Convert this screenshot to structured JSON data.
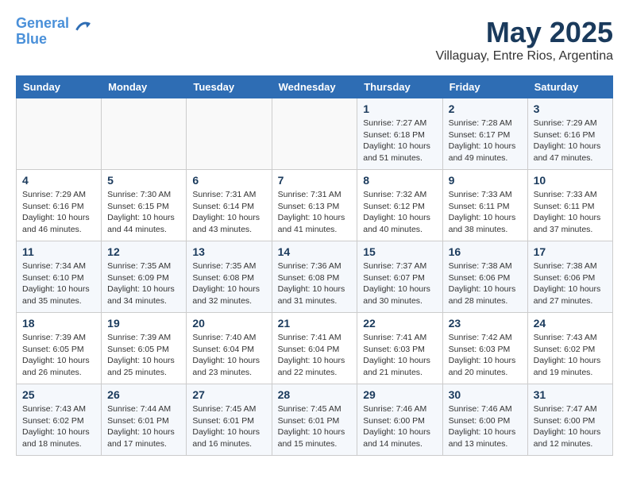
{
  "header": {
    "logo_line1": "General",
    "logo_line2": "Blue",
    "month_year": "May 2025",
    "location": "Villaguay, Entre Rios, Argentina"
  },
  "days_of_week": [
    "Sunday",
    "Monday",
    "Tuesday",
    "Wednesday",
    "Thursday",
    "Friday",
    "Saturday"
  ],
  "weeks": [
    [
      {
        "day": "",
        "info": ""
      },
      {
        "day": "",
        "info": ""
      },
      {
        "day": "",
        "info": ""
      },
      {
        "day": "",
        "info": ""
      },
      {
        "day": "1",
        "info": "Sunrise: 7:27 AM\nSunset: 6:18 PM\nDaylight: 10 hours\nand 51 minutes."
      },
      {
        "day": "2",
        "info": "Sunrise: 7:28 AM\nSunset: 6:17 PM\nDaylight: 10 hours\nand 49 minutes."
      },
      {
        "day": "3",
        "info": "Sunrise: 7:29 AM\nSunset: 6:16 PM\nDaylight: 10 hours\nand 47 minutes."
      }
    ],
    [
      {
        "day": "4",
        "info": "Sunrise: 7:29 AM\nSunset: 6:16 PM\nDaylight: 10 hours\nand 46 minutes."
      },
      {
        "day": "5",
        "info": "Sunrise: 7:30 AM\nSunset: 6:15 PM\nDaylight: 10 hours\nand 44 minutes."
      },
      {
        "day": "6",
        "info": "Sunrise: 7:31 AM\nSunset: 6:14 PM\nDaylight: 10 hours\nand 43 minutes."
      },
      {
        "day": "7",
        "info": "Sunrise: 7:31 AM\nSunset: 6:13 PM\nDaylight: 10 hours\nand 41 minutes."
      },
      {
        "day": "8",
        "info": "Sunrise: 7:32 AM\nSunset: 6:12 PM\nDaylight: 10 hours\nand 40 minutes."
      },
      {
        "day": "9",
        "info": "Sunrise: 7:33 AM\nSunset: 6:11 PM\nDaylight: 10 hours\nand 38 minutes."
      },
      {
        "day": "10",
        "info": "Sunrise: 7:33 AM\nSunset: 6:11 PM\nDaylight: 10 hours\nand 37 minutes."
      }
    ],
    [
      {
        "day": "11",
        "info": "Sunrise: 7:34 AM\nSunset: 6:10 PM\nDaylight: 10 hours\nand 35 minutes."
      },
      {
        "day": "12",
        "info": "Sunrise: 7:35 AM\nSunset: 6:09 PM\nDaylight: 10 hours\nand 34 minutes."
      },
      {
        "day": "13",
        "info": "Sunrise: 7:35 AM\nSunset: 6:08 PM\nDaylight: 10 hours\nand 32 minutes."
      },
      {
        "day": "14",
        "info": "Sunrise: 7:36 AM\nSunset: 6:08 PM\nDaylight: 10 hours\nand 31 minutes."
      },
      {
        "day": "15",
        "info": "Sunrise: 7:37 AM\nSunset: 6:07 PM\nDaylight: 10 hours\nand 30 minutes."
      },
      {
        "day": "16",
        "info": "Sunrise: 7:38 AM\nSunset: 6:06 PM\nDaylight: 10 hours\nand 28 minutes."
      },
      {
        "day": "17",
        "info": "Sunrise: 7:38 AM\nSunset: 6:06 PM\nDaylight: 10 hours\nand 27 minutes."
      }
    ],
    [
      {
        "day": "18",
        "info": "Sunrise: 7:39 AM\nSunset: 6:05 PM\nDaylight: 10 hours\nand 26 minutes."
      },
      {
        "day": "19",
        "info": "Sunrise: 7:39 AM\nSunset: 6:05 PM\nDaylight: 10 hours\nand 25 minutes."
      },
      {
        "day": "20",
        "info": "Sunrise: 7:40 AM\nSunset: 6:04 PM\nDaylight: 10 hours\nand 23 minutes."
      },
      {
        "day": "21",
        "info": "Sunrise: 7:41 AM\nSunset: 6:04 PM\nDaylight: 10 hours\nand 22 minutes."
      },
      {
        "day": "22",
        "info": "Sunrise: 7:41 AM\nSunset: 6:03 PM\nDaylight: 10 hours\nand 21 minutes."
      },
      {
        "day": "23",
        "info": "Sunrise: 7:42 AM\nSunset: 6:03 PM\nDaylight: 10 hours\nand 20 minutes."
      },
      {
        "day": "24",
        "info": "Sunrise: 7:43 AM\nSunset: 6:02 PM\nDaylight: 10 hours\nand 19 minutes."
      }
    ],
    [
      {
        "day": "25",
        "info": "Sunrise: 7:43 AM\nSunset: 6:02 PM\nDaylight: 10 hours\nand 18 minutes."
      },
      {
        "day": "26",
        "info": "Sunrise: 7:44 AM\nSunset: 6:01 PM\nDaylight: 10 hours\nand 17 minutes."
      },
      {
        "day": "27",
        "info": "Sunrise: 7:45 AM\nSunset: 6:01 PM\nDaylight: 10 hours\nand 16 minutes."
      },
      {
        "day": "28",
        "info": "Sunrise: 7:45 AM\nSunset: 6:01 PM\nDaylight: 10 hours\nand 15 minutes."
      },
      {
        "day": "29",
        "info": "Sunrise: 7:46 AM\nSunset: 6:00 PM\nDaylight: 10 hours\nand 14 minutes."
      },
      {
        "day": "30",
        "info": "Sunrise: 7:46 AM\nSunset: 6:00 PM\nDaylight: 10 hours\nand 13 minutes."
      },
      {
        "day": "31",
        "info": "Sunrise: 7:47 AM\nSunset: 6:00 PM\nDaylight: 10 hours\nand 12 minutes."
      }
    ]
  ]
}
